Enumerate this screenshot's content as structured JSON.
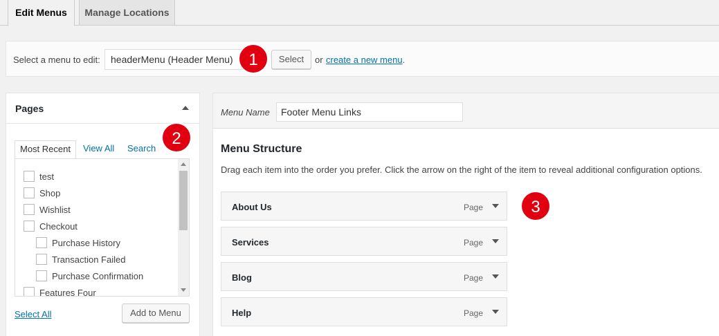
{
  "tabs": {
    "edit_menus": "Edit Menus",
    "manage_locations": "Manage Locations"
  },
  "manage": {
    "label": "Select a menu to edit:",
    "selected_menu": "headerMenu (Header Menu)",
    "select_button": "Select",
    "or_text": "or",
    "create_link": "create a new menu",
    "create_link_suffix": "."
  },
  "badges": [
    "1",
    "2",
    "3"
  ],
  "pages_panel": {
    "title": "Pages",
    "tabs": [
      "Most Recent",
      "View All",
      "Search"
    ],
    "items": [
      {
        "label": "test",
        "level": 0
      },
      {
        "label": "Shop",
        "level": 0
      },
      {
        "label": "Wishlist",
        "level": 0
      },
      {
        "label": "Checkout",
        "level": 0
      },
      {
        "label": "Purchase History",
        "level": 1
      },
      {
        "label": "Transaction Failed",
        "level": 1
      },
      {
        "label": "Purchase Confirmation",
        "level": 1
      },
      {
        "label": "Features Four",
        "level": 0
      }
    ],
    "select_all": "Select All",
    "add_button": "Add to Menu"
  },
  "menu_panel": {
    "name_label": "Menu Name",
    "name_value": "Footer Menu Links",
    "structure_title": "Menu Structure",
    "structure_desc": "Drag each item into the order you prefer. Click the arrow on the right of the item to reveal additional configuration options.",
    "items": [
      {
        "title": "About Us",
        "type": "Page"
      },
      {
        "title": "Services",
        "type": "Page"
      },
      {
        "title": "Blog",
        "type": "Page"
      },
      {
        "title": "Help",
        "type": "Page"
      }
    ]
  },
  "colors": {
    "badge": "#e0000f",
    "link": "#0073aa"
  }
}
